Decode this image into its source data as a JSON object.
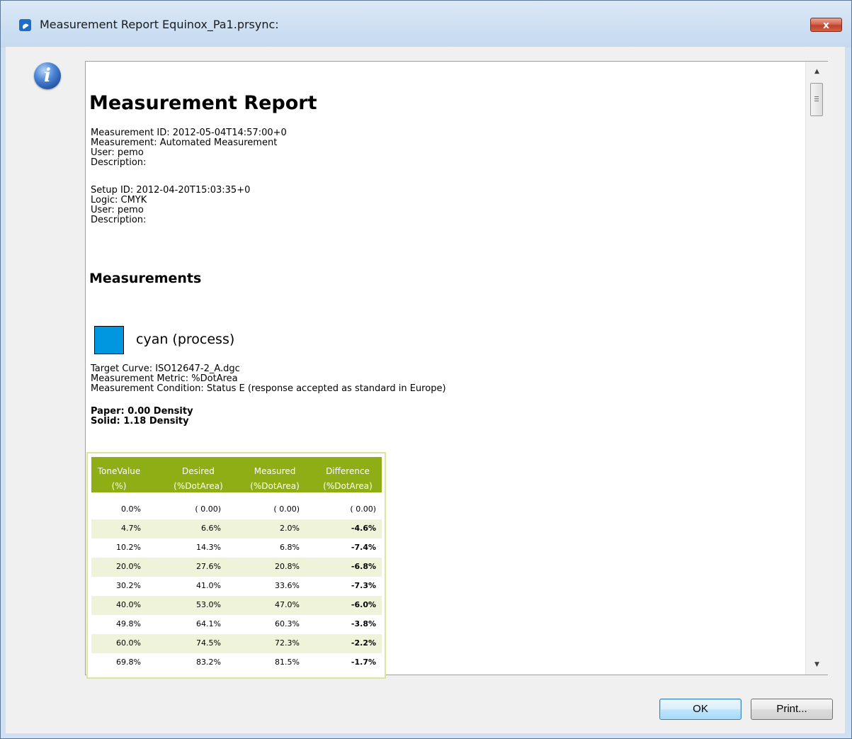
{
  "window": {
    "title": "Measurement Report Equinox_Pa1.prsync:",
    "close_label": "x"
  },
  "dialog_icon": {
    "name": "info-icon",
    "glyph": "i"
  },
  "report": {
    "title": "Measurement Report",
    "measurement_lines": [
      "Measurement ID: 2012-05-04T14:57:00+0",
      "Measurement: Automated Measurement",
      "User: pemo",
      "Description:"
    ],
    "setup_lines": [
      "Setup ID: 2012-04-20T15:03:35+0",
      "Logic: CMYK",
      "User: pemo",
      "Description:"
    ],
    "section_title": "Measurements",
    "color": {
      "name": "cyan (process)",
      "swatch_color": "#0096e0",
      "info_lines": [
        "Target Curve: ISO12647-2_A.dgc",
        "Measurement Metric: %DotArea",
        "Measurement Condition: Status E (response accepted as standard in Europe)"
      ],
      "density_lines": [
        "Paper: 0.00 Density",
        "Solid: 1.18 Density"
      ]
    },
    "table": {
      "header_color": "#8fae15",
      "alt_row_color": "#eef3d9",
      "headers": [
        [
          "ToneValue",
          "(%)"
        ],
        [
          "Desired",
          "(%DotArea)"
        ],
        [
          "Measured",
          "(%DotArea)"
        ],
        [
          "Difference",
          "(%DotArea)"
        ]
      ],
      "rows": [
        [
          "0.0%",
          "( 0.00)",
          "( 0.00)",
          "( 0.00)"
        ],
        [
          "4.7%",
          "6.6%",
          "2.0%",
          "-4.6%"
        ],
        [
          "10.2%",
          "14.3%",
          "6.8%",
          "-7.4%"
        ],
        [
          "20.0%",
          "27.6%",
          "20.8%",
          "-6.8%"
        ],
        [
          "30.2%",
          "41.0%",
          "33.6%",
          "-7.3%"
        ],
        [
          "40.0%",
          "53.0%",
          "47.0%",
          "-6.0%"
        ],
        [
          "49.8%",
          "64.1%",
          "60.3%",
          "-3.8%"
        ],
        [
          "60.0%",
          "74.5%",
          "72.3%",
          "-2.2%"
        ],
        [
          "69.8%",
          "83.2%",
          "81.5%",
          "-1.7%"
        ]
      ]
    }
  },
  "scrollbar": {
    "up_glyph": "▲",
    "down_glyph": "▼"
  },
  "buttons": {
    "ok": "OK",
    "print": "Print..."
  }
}
